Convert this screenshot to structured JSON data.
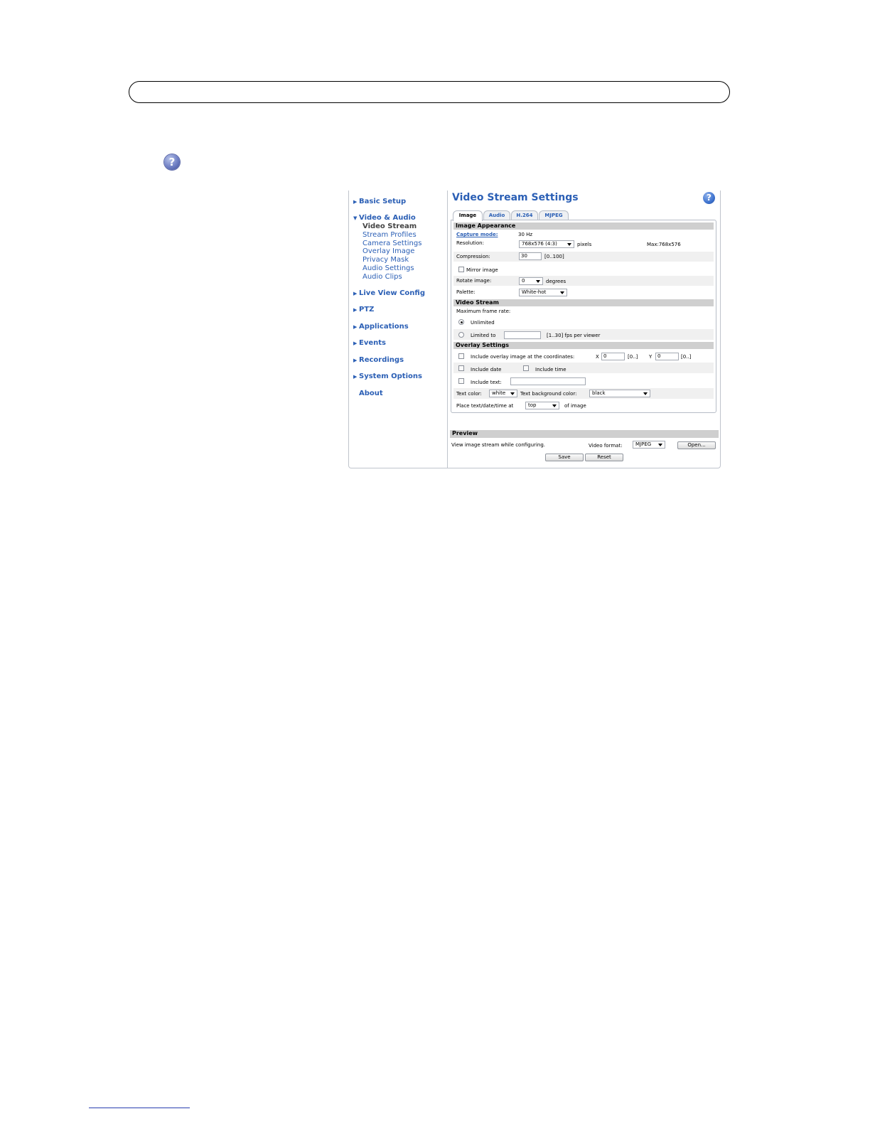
{
  "sidebar": {
    "items": [
      {
        "label": "Basic Setup"
      },
      {
        "label": "Video & Audio"
      },
      {
        "label": "Live View Config"
      },
      {
        "label": "PTZ"
      },
      {
        "label": "Applications"
      },
      {
        "label": "Events"
      },
      {
        "label": "Recordings"
      },
      {
        "label": "System Options"
      },
      {
        "label": "About"
      }
    ],
    "sub_items": [
      "Video Stream",
      "Stream Profiles",
      "Camera Settings",
      "Overlay Image",
      "Privacy Mask",
      "Audio Settings",
      "Audio Clips"
    ],
    "active_sub_item": "Video Stream"
  },
  "main": {
    "title": "Video Stream Settings",
    "tabs": [
      "Image",
      "Audio",
      "H.264",
      "MJPEG"
    ],
    "active_tab": "Image"
  },
  "image_appearance": {
    "heading": "Image Appearance",
    "capture_mode_label": "Capture mode:",
    "capture_mode_value": "30 Hz",
    "resolution_label": "Resolution:",
    "resolution_value": "768x576 (4:3)",
    "resolution_unit": "pixels",
    "max_resolution": "Max:768x576",
    "compression_label": "Compression:",
    "compression_value": "30",
    "compression_range": "[0..100]",
    "mirror_label": "Mirror image",
    "rotate_label": "Rotate image:",
    "rotate_value": "0",
    "rotate_unit": "degrees",
    "palette_label": "Palette:",
    "palette_value": "White-hot"
  },
  "video_stream": {
    "heading": "Video Stream",
    "max_frame_rate_label": "Maximum frame rate:",
    "unlimited_label": "Unlimited",
    "limited_label": "Limited to",
    "limited_value": "",
    "fps_hint": "[1..30] fps per viewer"
  },
  "overlay": {
    "heading": "Overlay Settings",
    "include_image_label": "Include overlay image at the coordinates:",
    "x_label": "X",
    "x_value": "0",
    "x_range": "[0..]",
    "y_label": "Y",
    "y_value": "0",
    "y_range": "[0..]",
    "include_date_label": "Include date",
    "include_time_label": "Include time",
    "include_text_label": "Include text:",
    "include_text_value": "",
    "text_color_label": "Text color:",
    "text_color_value": "white",
    "text_bg_color_label": "Text background color:",
    "text_bg_color_value": "black",
    "place_label": "Place text/date/time at",
    "place_value": "top",
    "place_suffix": "of image"
  },
  "preview": {
    "heading": "Preview",
    "description": "View image stream while configuring.",
    "video_format_label": "Video format:",
    "video_format_value": "MJPEG",
    "open_label": "Open..."
  },
  "buttons": {
    "save": "Save",
    "reset": "Reset"
  },
  "help_icon_glyph": "?",
  "colors": {
    "link_blue": "#2b5fb5",
    "section_header": "#cfcfcf"
  }
}
